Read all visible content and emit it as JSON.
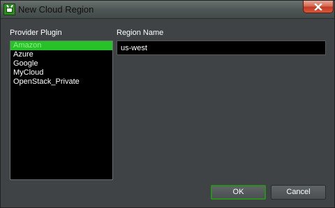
{
  "window": {
    "title": "New Cloud Region",
    "app_icon": "tv-icon",
    "close_icon": "close-icon"
  },
  "provider": {
    "label": "Provider Plugin",
    "items": [
      "Amazon",
      "Azure",
      "Google",
      "MyCloud",
      "OpenStack_Private"
    ],
    "selected_index": 0
  },
  "region": {
    "label": "Region Name",
    "value": "us-west"
  },
  "buttons": {
    "ok_label": "OK",
    "cancel_label": "Cancel"
  },
  "colors": {
    "accent": "#27c227",
    "background": "#3f4346",
    "field": "#000000"
  }
}
